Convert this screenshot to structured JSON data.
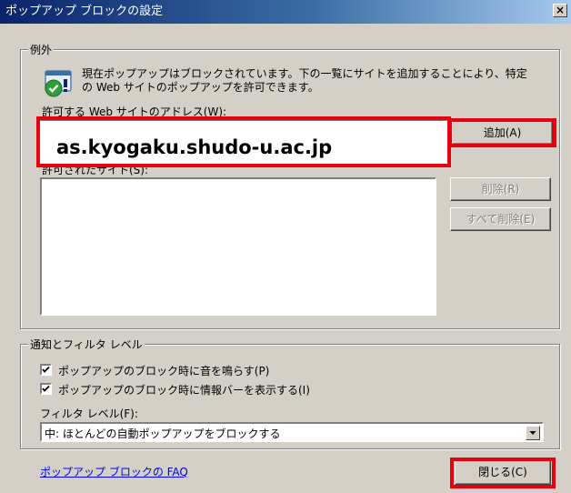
{
  "window": {
    "title": "ポップアップ ブロックの設定",
    "close_symbol": "×"
  },
  "exceptions": {
    "group_label": "例外",
    "info_line1": "現在ポップアップはブロックされています。下の一覧にサイトを追加することにより、特定",
    "info_line2": "の Web サイトのポップアップを許可できます。",
    "address_label": "許可する Web サイトのアドレス(W):",
    "address_value": "as.kyogaku.shudo-u.ac.jp",
    "add_button": "追加(A)",
    "allowed_sites_label": "許可されたサイト(S):",
    "allowed_sites": [],
    "remove_button": "削除(R)",
    "remove_all_button": "すべて削除(E)"
  },
  "notifications": {
    "group_label": "通知とフィルタ レベル",
    "play_sound": {
      "label": "ポップアップのブロック時に音を鳴らす(P)",
      "checked": true
    },
    "show_info_bar": {
      "label": "ポップアップのブロック時に情報バーを表示する(I)",
      "checked": true
    },
    "filter_level_label": "フィルタ レベル(F):",
    "filter_level_value": "中: ほとんどの自動ポップアップをブロックする"
  },
  "footer": {
    "faq_link": "ポップアップ ブロックの FAQ",
    "close_button": "閉じる(C)"
  },
  "colors": {
    "dialog_bg": "#d4d0c8",
    "highlight_red": "#e60012",
    "link_blue": "#0000ff",
    "title_gradient_start": "#0a246a"
  }
}
